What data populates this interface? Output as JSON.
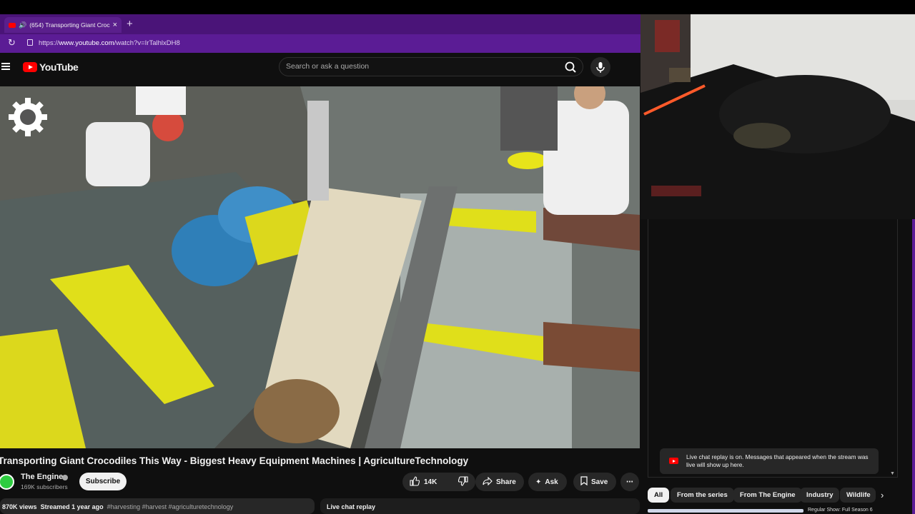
{
  "browser": {
    "tab_title": "(654) Transporting Giant Croc",
    "tab_close": "×",
    "new_tab": "+",
    "url_prefix": "https://",
    "url_domain": "www.youtube.com",
    "url_path": "/watch?v=IrTalhlxDH8",
    "accent_color": "#5b1c95"
  },
  "youtube": {
    "logo_text": "YouTube",
    "search_placeholder": "Search or ask a question",
    "icons": [
      "menu-icon",
      "search-icon",
      "mic-icon"
    ]
  },
  "video": {
    "title": "Transporting Giant Crocodiles This Way - Biggest Heavy Equipment Machines | AgricultureTechnology",
    "overlay_icon": "gear-logo-icon"
  },
  "channel": {
    "name": "The Engine",
    "subscribers": "169K subscribers",
    "subscribe_label": "Subscribe"
  },
  "actions": {
    "likes": "14K",
    "share": "Share",
    "ask": "Ask",
    "save": "Save"
  },
  "description": {
    "views": "870K views",
    "streamed": "Streamed 1 year ago",
    "tags": "#harvesting #harvest #agriculturetechnology"
  },
  "chat": {
    "replay_bar_label": "Live chat replay",
    "replay_notice": "Live chat replay is on. Messages that appeared when the stream was live will show up here."
  },
  "chips": [
    "All",
    "From the series",
    "From The Engine",
    "Industry",
    "Wildlife"
  ],
  "next_video_title": "Regular Show: Full Season 6"
}
